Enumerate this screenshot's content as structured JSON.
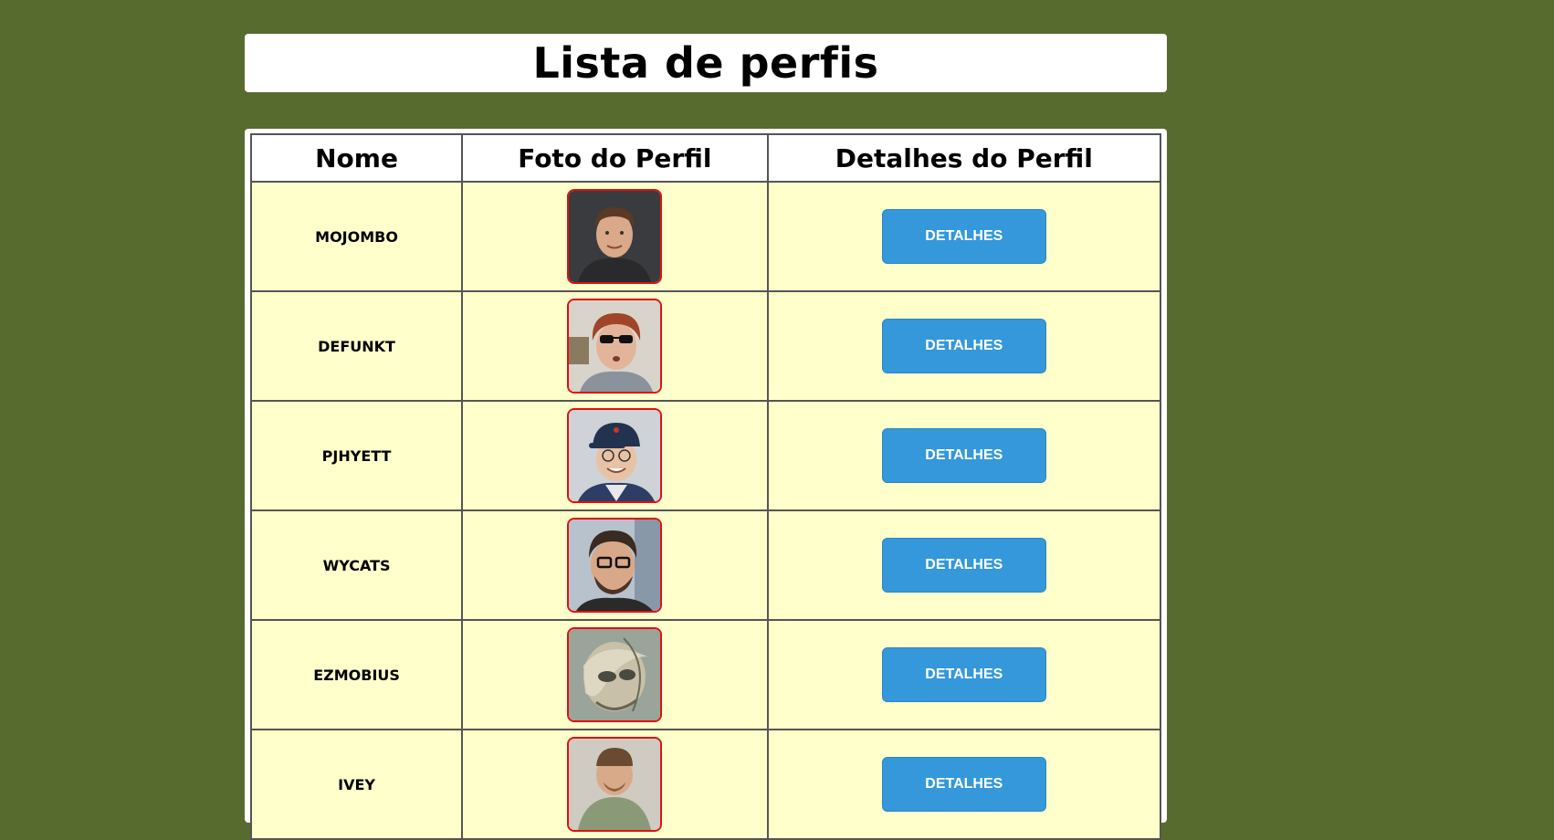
{
  "page": {
    "title": "Lista de perfis",
    "background_color": "#586b2f"
  },
  "table": {
    "headers": {
      "name": "Nome",
      "photo": "Foto do Perfil",
      "details": "Detalhes do Perfil"
    },
    "rows": [
      {
        "name": "MOJOMBO",
        "button_label": "DETALHES",
        "avatar": "profile-photo-mojombo"
      },
      {
        "name": "DEFUNKT",
        "button_label": "DETALHES",
        "avatar": "profile-photo-defunkt"
      },
      {
        "name": "PJHYETT",
        "button_label": "DETALHES",
        "avatar": "profile-photo-pjhyett"
      },
      {
        "name": "WYCATS",
        "button_label": "DETALHES",
        "avatar": "profile-photo-wycats"
      },
      {
        "name": "EZMOBIUS",
        "button_label": "DETALHES",
        "avatar": "profile-photo-ezmobius"
      },
      {
        "name": "IVEY",
        "button_label": "DETALHES",
        "avatar": "profile-photo-ivey"
      }
    ]
  },
  "colors": {
    "row_background": "#ffffcc",
    "button": "#3498db",
    "avatar_border": "#e01010"
  }
}
